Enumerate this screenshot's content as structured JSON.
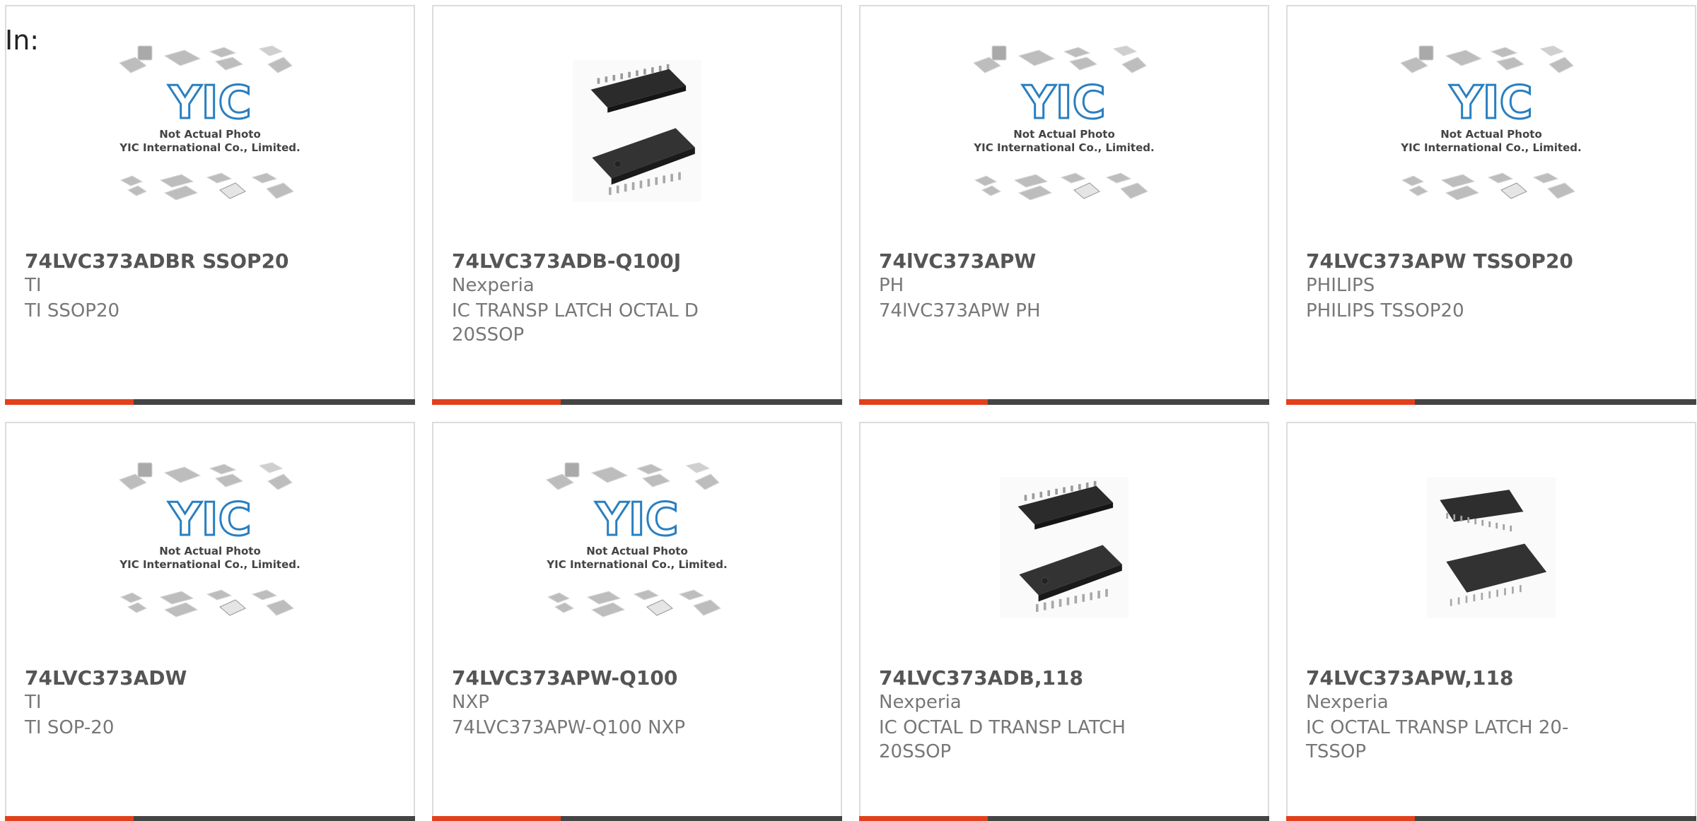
{
  "header": {
    "in_label": "In:"
  },
  "placeholder": {
    "logo_text": "YIC",
    "line1": "Not Actual Photo",
    "line2": "YIC International Co., Limited."
  },
  "colors": {
    "accent": "#e2401c",
    "bar": "#444444",
    "logo": "#2a7fc0"
  },
  "products": [
    {
      "name": "74LVC373ADBR SSOP20",
      "maker": "TI",
      "desc": "TI SSOP20",
      "image": "yic-placeholder"
    },
    {
      "name": "74LVC373ADB-Q100J",
      "maker": "Nexperia",
      "desc": "IC TRANSP LATCH OCTAL D 20SSOP",
      "image": "ssop-chip-photo"
    },
    {
      "name": "74lVC373APW",
      "maker": "PH",
      "desc": "74lVC373APW PH",
      "image": "yic-placeholder"
    },
    {
      "name": "74LVC373APW TSSOP20",
      "maker": "PHILIPS",
      "desc": "PHILIPS TSSOP20",
      "image": "yic-placeholder"
    },
    {
      "name": "74LVC373ADW",
      "maker": "TI",
      "desc": "TI SOP-20",
      "image": "yic-placeholder"
    },
    {
      "name": "74LVC373APW-Q100",
      "maker": "NXP",
      "desc": "74LVC373APW-Q100 NXP",
      "image": "yic-placeholder"
    },
    {
      "name": "74LVC373ADB,118",
      "maker": "Nexperia",
      "desc": "IC OCTAL D TRANSP LATCH 20SSOP",
      "image": "ssop-chip-photo"
    },
    {
      "name": "74LVC373APW,118",
      "maker": "Nexperia",
      "desc": "IC OCTAL TRANSP LATCH 20-TSSOP",
      "image": "tssop-chip-photo"
    }
  ]
}
